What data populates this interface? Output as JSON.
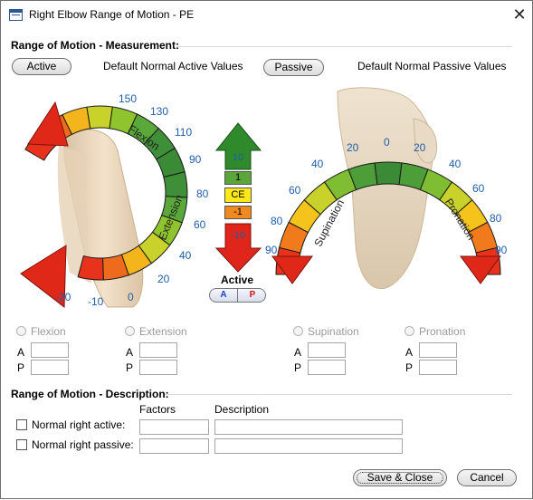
{
  "window": {
    "title": "Right Elbow Range of Motion - PE"
  },
  "measurement": {
    "section_title": "Range of Motion - Measurement:",
    "active_button": "Active",
    "active_defaults": "Default Normal Active Values",
    "passive_button": "Passive",
    "passive_defaults": "Default Normal Passive Values"
  },
  "flexion_diagram": {
    "ticks": [
      "150",
      "130",
      "110",
      "90",
      "80",
      "60",
      "40",
      "20",
      "0",
      "-10",
      "-20"
    ],
    "arc_labels": {
      "flexion": "Flexion",
      "extension": "Extension"
    }
  },
  "indicator": {
    "values": [
      "10",
      "1",
      "CE",
      "-1",
      "-10"
    ],
    "mode_label": "Active",
    "toggle_a": "A",
    "toggle_p": "P",
    "colors": {
      "a": "#1a3fd1",
      "p": "#d01414"
    }
  },
  "rotation_diagram": {
    "left_ticks": [
      "90",
      "80",
      "60",
      "40",
      "20"
    ],
    "top_tick": "0",
    "right_ticks": [
      "20",
      "40",
      "60",
      "80",
      "90"
    ],
    "arc_labels": {
      "supination": "Supination",
      "pronation": "Pronation"
    }
  },
  "motions": [
    {
      "name": "Flexion",
      "a_label": "A",
      "p_label": "P",
      "a_value": "",
      "p_value": ""
    },
    {
      "name": "Extension",
      "a_label": "A",
      "p_label": "P",
      "a_value": "",
      "p_value": ""
    },
    {
      "name": "Supination",
      "a_label": "A",
      "p_label": "P",
      "a_value": "",
      "p_value": ""
    },
    {
      "name": "Pronation",
      "a_label": "A",
      "p_label": "P",
      "a_value": "",
      "p_value": ""
    }
  ],
  "description": {
    "section_title": "Range of Motion - Description:",
    "factors_header": "Factors",
    "description_header": "Description",
    "rows": [
      {
        "label": "Normal right active:",
        "factors": "",
        "description": ""
      },
      {
        "label": "Normal right passive:",
        "factors": "",
        "description": ""
      }
    ]
  },
  "actions": {
    "save_close": "Save & Close",
    "cancel": "Cancel"
  }
}
